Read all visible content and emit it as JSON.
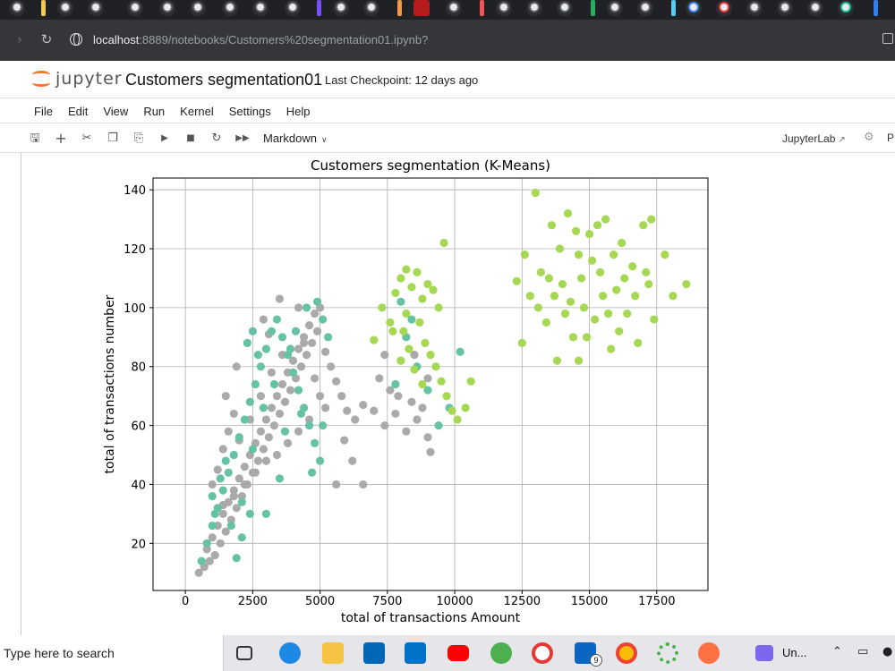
{
  "browser": {
    "url_host": "localhost",
    "url_path": ":8889/notebooks/Customers%20segmentation01.ipynb?"
  },
  "jupyter": {
    "logo_text": "jupyter",
    "notebook_title": "Customers segmentation01",
    "checkpoint": "Last Checkpoint: 12 days ago",
    "menu": [
      "File",
      "Edit",
      "View",
      "Run",
      "Kernel",
      "Settings",
      "Help"
    ],
    "toolbar": {
      "cell_type": "Markdown",
      "jupyterlab_link": "JupyterLab",
      "truncated_item": "P"
    }
  },
  "chart_data": {
    "type": "scatter",
    "title": "Customers segmentation (K-Means)",
    "xlabel": "total of transactions Amount",
    "ylabel": "total of transactions number",
    "xlim": [
      -1200,
      19400
    ],
    "ylim": [
      4,
      144
    ],
    "xticks": [
      0,
      2500,
      5000,
      7500,
      10000,
      12500,
      15000,
      17500
    ],
    "yticks": [
      20,
      40,
      60,
      80,
      100,
      120,
      140
    ],
    "grid": true,
    "series": [
      {
        "color": "#aaaaaa",
        "points": [
          [
            500,
            10
          ],
          [
            700,
            12
          ],
          [
            800,
            18
          ],
          [
            900,
            14
          ],
          [
            1000,
            22
          ],
          [
            1100,
            16
          ],
          [
            1200,
            26
          ],
          [
            1300,
            20
          ],
          [
            1400,
            30
          ],
          [
            1500,
            24
          ],
          [
            1600,
            34
          ],
          [
            1700,
            28
          ],
          [
            1800,
            38
          ],
          [
            1900,
            32
          ],
          [
            2000,
            42
          ],
          [
            2100,
            36
          ],
          [
            2200,
            46
          ],
          [
            2300,
            40
          ],
          [
            2400,
            50
          ],
          [
            2500,
            44
          ],
          [
            2600,
            54
          ],
          [
            2700,
            48
          ],
          [
            2800,
            58
          ],
          [
            2900,
            52
          ],
          [
            3000,
            62
          ],
          [
            3100,
            56
          ],
          [
            3200,
            66
          ],
          [
            3300,
            60
          ],
          [
            3400,
            70
          ],
          [
            3500,
            64
          ],
          [
            3600,
            74
          ],
          [
            3700,
            68
          ],
          [
            3800,
            78
          ],
          [
            3900,
            72
          ],
          [
            4000,
            82
          ],
          [
            4100,
            76
          ],
          [
            4200,
            86
          ],
          [
            4300,
            80
          ],
          [
            4400,
            90
          ],
          [
            4500,
            84
          ],
          [
            4600,
            94
          ],
          [
            4700,
            88
          ],
          [
            4800,
            98
          ],
          [
            4900,
            92
          ],
          [
            5000,
            100
          ],
          [
            5200,
            85
          ],
          [
            5400,
            80
          ],
          [
            5600,
            75
          ],
          [
            5800,
            70
          ],
          [
            6000,
            65
          ],
          [
            6300,
            62
          ],
          [
            6600,
            67
          ],
          [
            7000,
            65
          ],
          [
            7400,
            60
          ],
          [
            7800,
            64
          ],
          [
            8200,
            58
          ],
          [
            8600,
            62
          ],
          [
            9000,
            56
          ],
          [
            9100,
            51
          ],
          [
            8800,
            66
          ],
          [
            7600,
            72
          ],
          [
            7200,
            76
          ],
          [
            7900,
            70
          ],
          [
            8400,
            68
          ],
          [
            3500,
            103
          ],
          [
            4200,
            100
          ],
          [
            2900,
            96
          ],
          [
            3100,
            91
          ],
          [
            1800,
            64
          ],
          [
            1600,
            58
          ],
          [
            1200,
            45
          ],
          [
            1000,
            40
          ],
          [
            1400,
            52
          ],
          [
            2000,
            55
          ],
          [
            2400,
            62
          ],
          [
            2800,
            70
          ],
          [
            3200,
            78
          ],
          [
            3600,
            84
          ],
          [
            4400,
            88
          ],
          [
            4800,
            76
          ],
          [
            5000,
            70
          ],
          [
            5200,
            66
          ],
          [
            4600,
            62
          ],
          [
            4200,
            58
          ],
          [
            3800,
            54
          ],
          [
            3400,
            50
          ],
          [
            3000,
            48
          ],
          [
            2600,
            44
          ],
          [
            2200,
            40
          ],
          [
            1800,
            36
          ],
          [
            1400,
            33
          ],
          [
            5600,
            40
          ],
          [
            6600,
            40
          ],
          [
            6200,
            48
          ],
          [
            5900,
            55
          ],
          [
            8000,
            82
          ],
          [
            8500,
            84
          ],
          [
            9000,
            76
          ],
          [
            7400,
            84
          ],
          [
            1500,
            70
          ],
          [
            1900,
            80
          ]
        ]
      },
      {
        "color": "#66c2a5",
        "points": [
          [
            600,
            14
          ],
          [
            800,
            20
          ],
          [
            1000,
            26
          ],
          [
            1200,
            32
          ],
          [
            1400,
            38
          ],
          [
            1600,
            44
          ],
          [
            1800,
            50
          ],
          [
            2000,
            56
          ],
          [
            2200,
            62
          ],
          [
            2400,
            68
          ],
          [
            2600,
            74
          ],
          [
            2800,
            80
          ],
          [
            3000,
            86
          ],
          [
            3200,
            92
          ],
          [
            3400,
            96
          ],
          [
            3600,
            90
          ],
          [
            3800,
            84
          ],
          [
            4000,
            78
          ],
          [
            4200,
            72
          ],
          [
            4400,
            66
          ],
          [
            4600,
            60
          ],
          [
            4800,
            54
          ],
          [
            5000,
            48
          ],
          [
            1900,
            15
          ],
          [
            1100,
            30
          ],
          [
            1500,
            48
          ],
          [
            2100,
            34
          ],
          [
            2500,
            52
          ],
          [
            2900,
            66
          ],
          [
            3300,
            74
          ],
          [
            3700,
            58
          ],
          [
            4100,
            92
          ],
          [
            4500,
            100
          ],
          [
            4900,
            102
          ],
          [
            5100,
            96
          ],
          [
            5300,
            90
          ],
          [
            2300,
            88
          ],
          [
            2500,
            92
          ],
          [
            2700,
            84
          ],
          [
            8000,
            102
          ],
          [
            8200,
            90
          ],
          [
            8600,
            80
          ],
          [
            9000,
            72
          ],
          [
            9400,
            60
          ],
          [
            9800,
            66
          ],
          [
            10200,
            85
          ],
          [
            8400,
            96
          ],
          [
            7800,
            74
          ],
          [
            3900,
            86
          ],
          [
            4300,
            64
          ],
          [
            4700,
            44
          ],
          [
            5100,
            60
          ],
          [
            1300,
            42
          ],
          [
            1700,
            26
          ],
          [
            2100,
            22
          ],
          [
            2400,
            30
          ],
          [
            1000,
            36
          ],
          [
            3500,
            42
          ],
          [
            3000,
            30
          ]
        ]
      },
      {
        "color": "#a6d854",
        "points": [
          [
            7000,
            89
          ],
          [
            7300,
            100
          ],
          [
            7600,
            95
          ],
          [
            7800,
            105
          ],
          [
            8000,
            110
          ],
          [
            8200,
            98
          ],
          [
            8400,
            107
          ],
          [
            8600,
            112
          ],
          [
            8800,
            103
          ],
          [
            9000,
            108
          ],
          [
            9200,
            106
          ],
          [
            9400,
            100
          ],
          [
            8100,
            92
          ],
          [
            8300,
            86
          ],
          [
            8500,
            79
          ],
          [
            8700,
            95
          ],
          [
            8900,
            88
          ],
          [
            9100,
            84
          ],
          [
            9300,
            80
          ],
          [
            9500,
            75
          ],
          [
            9700,
            70
          ],
          [
            9900,
            65
          ],
          [
            10100,
            62
          ],
          [
            10400,
            66
          ],
          [
            10600,
            75
          ],
          [
            9600,
            122
          ],
          [
            8200,
            113
          ],
          [
            7700,
            92
          ],
          [
            8000,
            82
          ],
          [
            8800,
            74
          ],
          [
            12300,
            109
          ],
          [
            12600,
            118
          ],
          [
            12800,
            104
          ],
          [
            13000,
            139
          ],
          [
            13200,
            112
          ],
          [
            13400,
            95
          ],
          [
            13600,
            128
          ],
          [
            13800,
            82
          ],
          [
            14000,
            108
          ],
          [
            14200,
            132
          ],
          [
            14400,
            90
          ],
          [
            14600,
            118
          ],
          [
            14800,
            100
          ],
          [
            15000,
            125
          ],
          [
            15200,
            96
          ],
          [
            15400,
            112
          ],
          [
            15600,
            130
          ],
          [
            15800,
            86
          ],
          [
            16000,
            106
          ],
          [
            16200,
            122
          ],
          [
            16400,
            98
          ],
          [
            16600,
            114
          ],
          [
            16800,
            88
          ],
          [
            17000,
            128
          ],
          [
            17200,
            108
          ],
          [
            17400,
            96
          ],
          [
            17800,
            118
          ],
          [
            18100,
            104
          ],
          [
            18600,
            108
          ],
          [
            13100,
            100
          ],
          [
            13500,
            110
          ],
          [
            13900,
            120
          ],
          [
            14300,
            102
          ],
          [
            14700,
            110
          ],
          [
            15100,
            116
          ],
          [
            15500,
            104
          ],
          [
            15900,
            118
          ],
          [
            16300,
            110
          ],
          [
            16700,
            104
          ],
          [
            17100,
            112
          ],
          [
            14100,
            98
          ],
          [
            14500,
            126
          ],
          [
            14900,
            90
          ],
          [
            15300,
            128
          ],
          [
            15700,
            98
          ],
          [
            13700,
            104
          ],
          [
            14600,
            82
          ],
          [
            12500,
            88
          ],
          [
            17300,
            130
          ],
          [
            16100,
            92
          ]
        ]
      }
    ]
  },
  "taskbar": {
    "search_placeholder": "Type here to search",
    "badge_count": "9",
    "running_app_label": "Un..."
  }
}
